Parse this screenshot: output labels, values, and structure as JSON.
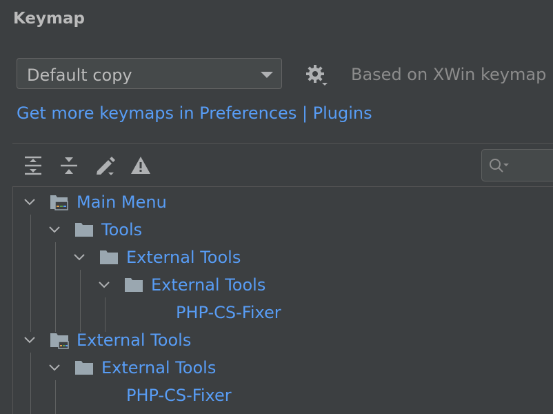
{
  "title": "Keymap",
  "keymap_select": {
    "value": "Default copy"
  },
  "based_on": "Based on XWin keymap",
  "plugins_link": "Get more keymaps in Preferences | Plugins",
  "toolbar": {
    "icons": [
      "expand-all-icon",
      "collapse-all-icon",
      "edit-icon",
      "conflicts-warning-icon"
    ]
  },
  "search": {
    "value": ""
  },
  "tree": {
    "nodes": [
      {
        "label": "Main Menu",
        "icon": "main-menu-icon",
        "expanded": true
      },
      {
        "label": "Tools",
        "icon": "folder-icon",
        "expanded": true
      },
      {
        "label": "External Tools",
        "icon": "folder-icon",
        "expanded": true
      },
      {
        "label": "External Tools",
        "icon": "folder-icon",
        "expanded": true
      },
      {
        "label": "PHP-CS-Fixer",
        "icon": "",
        "expanded": false
      },
      {
        "label": "External Tools",
        "icon": "external-tools-icon",
        "expanded": true
      },
      {
        "label": "External Tools",
        "icon": "folder-icon",
        "expanded": true
      },
      {
        "label": "PHP-CS-Fixer",
        "icon": "",
        "expanded": false
      }
    ]
  }
}
